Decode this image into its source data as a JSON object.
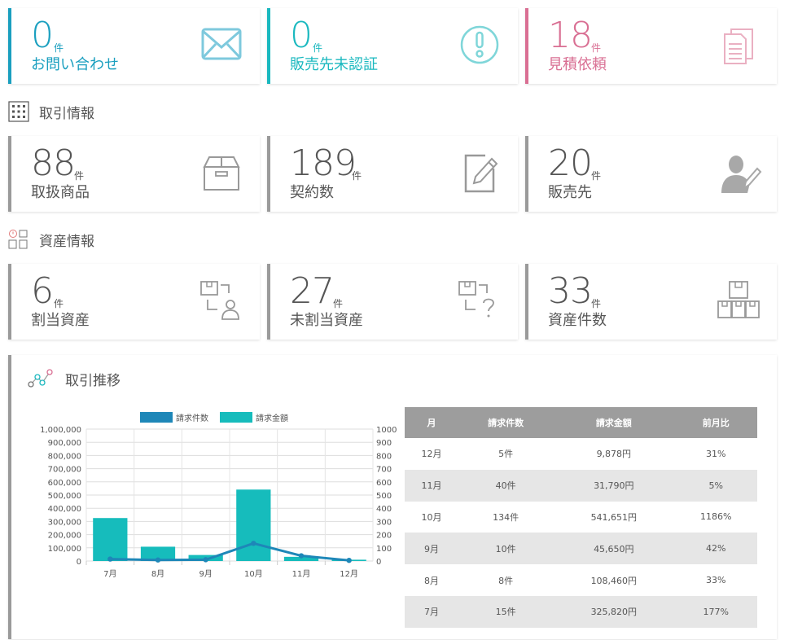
{
  "summary": [
    {
      "count": "0",
      "unit": "件",
      "label": "お問い合わせ",
      "color": "#1a9fbf",
      "icon": "envelope-icon"
    },
    {
      "count": "0",
      "unit": "件",
      "label": "販売先未認証",
      "color": "#1ab8bf",
      "icon": "alert-circle-icon"
    },
    {
      "count": "18",
      "unit": "件",
      "label": "見積依頼",
      "color": "#d96f93",
      "icon": "documents-icon"
    }
  ],
  "sections": {
    "trade": {
      "title": "取引情報",
      "icon": "grid-icon"
    },
    "asset": {
      "title": "資産情報",
      "icon": "asset-boxes-icon"
    },
    "trend": {
      "title": "取引推移",
      "icon": "trend-chart-icon"
    }
  },
  "trade_cards": [
    {
      "count": "88",
      "unit": "件",
      "label": "取扱商品",
      "icon": "box-icon"
    },
    {
      "count": "189",
      "unit": "件",
      "label": "契約数",
      "icon": "edit-document-icon"
    },
    {
      "count": "20",
      "unit": "件",
      "label": "販売先",
      "icon": "user-pen-icon"
    }
  ],
  "asset_cards": [
    {
      "count": "6",
      "unit": "件",
      "label": "割当資産",
      "icon": "assigned-asset-icon"
    },
    {
      "count": "27",
      "unit": "件",
      "label": "未割当資産",
      "icon": "unassigned-asset-icon"
    },
    {
      "count": "33",
      "unit": "件",
      "label": "資産件数",
      "icon": "stacked-boxes-icon"
    }
  ],
  "colors": {
    "neutral_accent": "#9a9a9a",
    "line_series": "#1e87b8",
    "bar_series": "#16bcbc",
    "table_header": "#9d9d9d"
  },
  "chart_data": {
    "type": "bar",
    "categories": [
      "7月",
      "8月",
      "9月",
      "10月",
      "11月",
      "12月"
    ],
    "series": [
      {
        "name": "請求件数",
        "type": "line",
        "axis": "right",
        "values": [
          15,
          8,
          10,
          134,
          40,
          5
        ]
      },
      {
        "name": "請求金額",
        "type": "bar",
        "axis": "left",
        "values": [
          325820,
          108460,
          45650,
          541651,
          31790,
          9878
        ]
      }
    ],
    "y_left": {
      "range": [
        0,
        1000000
      ],
      "ticks": [
        "1,000,000",
        "900,000",
        "800,000",
        "700,000",
        "600,000",
        "500,000",
        "400,000",
        "300,000",
        "200,000",
        "100,000",
        "0"
      ]
    },
    "y_right": {
      "range": [
        0,
        1000
      ],
      "ticks": [
        "1000",
        "900",
        "800",
        "700",
        "600",
        "500",
        "400",
        "300",
        "200",
        "100",
        "0"
      ]
    },
    "grid": true,
    "legend": "top"
  },
  "table": {
    "headers": [
      "月",
      "請求件数",
      "請求金額",
      "前月比"
    ],
    "rows": [
      [
        "12月",
        "5件",
        "9,878円",
        "31%"
      ],
      [
        "11月",
        "40件",
        "31,790円",
        "5%"
      ],
      [
        "10月",
        "134件",
        "541,651円",
        "1186%"
      ],
      [
        "9月",
        "10件",
        "45,650円",
        "42%"
      ],
      [
        "8月",
        "8件",
        "108,460円",
        "33%"
      ],
      [
        "7月",
        "15件",
        "325,820円",
        "177%"
      ]
    ]
  }
}
